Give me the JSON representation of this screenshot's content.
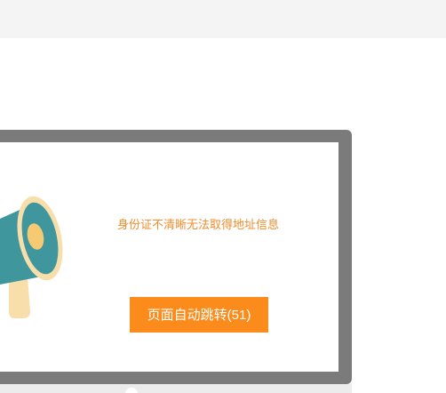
{
  "notice": {
    "message": "身份证不清晰无法取得地址信息",
    "redirect_label": "页面自动跳转(51)"
  },
  "icons": {
    "illustration": "megaphone-icon"
  },
  "colors": {
    "accent": "#fb8b1a",
    "message_text": "#ef8d2e",
    "frame": "#7b7b7b",
    "top_bar": "#f4f4f4"
  }
}
